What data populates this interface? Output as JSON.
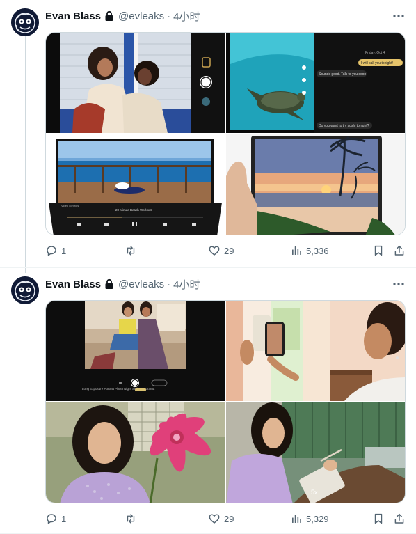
{
  "tweets": [
    {
      "author": {
        "name": "Evan Blass",
        "handle": "@evleaks",
        "separator": "·",
        "time": "4小时"
      },
      "media": {
        "images": [
          {
            "icon": "photo-friends-piggyback-camera-ui"
          },
          {
            "icon": "photo-sea-turtle-video-and-messages"
          },
          {
            "icon": "photo-foldable-video-player-deck"
          },
          {
            "icon": "photo-hand-holding-beach-sunset"
          }
        ],
        "overlay_text": {
          "msg_1": "I will call you tonight!",
          "msg_2": "Sounds good. Talk to you soon",
          "msg_3": "Do you want to try sushi tonight?",
          "date": "Friday, Oct 4",
          "player_title": "20 Minute Beach Workout",
          "player_sub": "Video controls"
        }
      },
      "stats": {
        "replies": "1",
        "retweets": "",
        "likes": "29",
        "views": "5,336"
      }
    },
    {
      "author": {
        "name": "Evan Blass",
        "handle": "@evleaks",
        "separator": "·",
        "time": "4小时"
      },
      "media": {
        "images": [
          {
            "icon": "photo-foldable-camera-two-women"
          },
          {
            "icon": "photo-woman-selfie-window"
          },
          {
            "icon": "photo-woman-pink-flower"
          },
          {
            "icon": "photo-woman-writing-stylus"
          }
        ],
        "overlay_text": {
          "modes": "Long Exposure   Portrait   Photo   Night Sight   Panorama",
          "zoom": "5x"
        }
      },
      "stats": {
        "replies": "1",
        "retweets": "",
        "likes": "29",
        "views": "5,329"
      }
    }
  ],
  "colors": {
    "text": "#0f1419",
    "muted": "#536471",
    "border": "#cfd9de",
    "avatar_bg": "#101a36"
  }
}
